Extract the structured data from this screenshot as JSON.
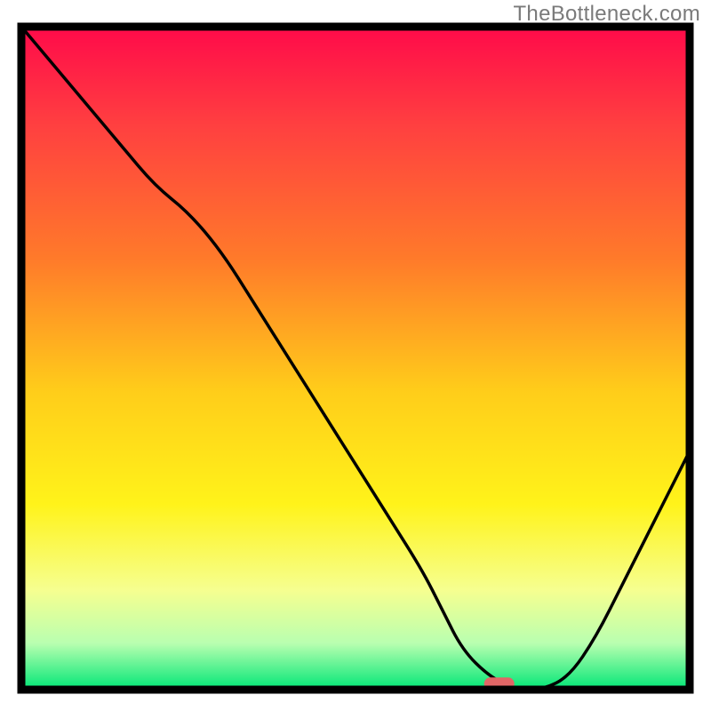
{
  "watermark": "TheBottleneck.com",
  "chart_data": {
    "type": "line",
    "title": "",
    "xlabel": "",
    "ylabel": "",
    "xlim": [
      0,
      100
    ],
    "ylim": [
      0,
      100
    ],
    "x": [
      0,
      5,
      10,
      15,
      20,
      25,
      30,
      35,
      40,
      45,
      50,
      55,
      60,
      63,
      66,
      70,
      74,
      78,
      82,
      86,
      90,
      94,
      98,
      100
    ],
    "y": [
      100,
      94,
      88,
      82,
      76,
      72,
      66,
      58,
      50,
      42,
      34,
      26,
      18,
      12,
      6,
      2,
      0,
      0,
      2,
      8,
      16,
      24,
      32,
      36
    ],
    "marker": {
      "x": 71.5,
      "y": 0.9,
      "color": "#e06666"
    },
    "gradient_stops": [
      {
        "offset": 0.0,
        "color": "#ff0a4a"
      },
      {
        "offset": 0.15,
        "color": "#ff4040"
      },
      {
        "offset": 0.35,
        "color": "#ff7a2a"
      },
      {
        "offset": 0.55,
        "color": "#ffcd1a"
      },
      {
        "offset": 0.72,
        "color": "#fff31a"
      },
      {
        "offset": 0.85,
        "color": "#f6ff90"
      },
      {
        "offset": 0.93,
        "color": "#b9ffb0"
      },
      {
        "offset": 1.0,
        "color": "#00e676"
      }
    ],
    "frame_color": "#000000",
    "line_color": "#000000"
  }
}
